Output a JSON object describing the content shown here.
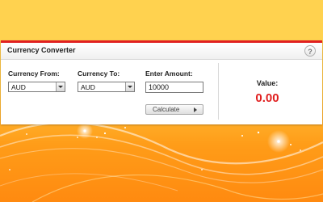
{
  "panel": {
    "title": "Currency Converter",
    "help_icon": "question-mark-icon",
    "help_glyph": "?"
  },
  "form": {
    "currency_from_label": "Currency From:",
    "currency_from_value": "AUD",
    "currency_to_label": "Currency To:",
    "currency_to_value": "AUD",
    "amount_label": "Enter Amount:",
    "amount_value": "10000",
    "calculate_label": "Calculate",
    "calculate_icon": "play-arrow-icon",
    "select_icon": "chevron-down-icon"
  },
  "result": {
    "label": "Value:",
    "amount": "0.00"
  },
  "colors": {
    "accent_red": "#e02020",
    "value_red": "#e01e1e",
    "background_orange": "#ff9c18",
    "background_yellow": "#ffd25a"
  }
}
